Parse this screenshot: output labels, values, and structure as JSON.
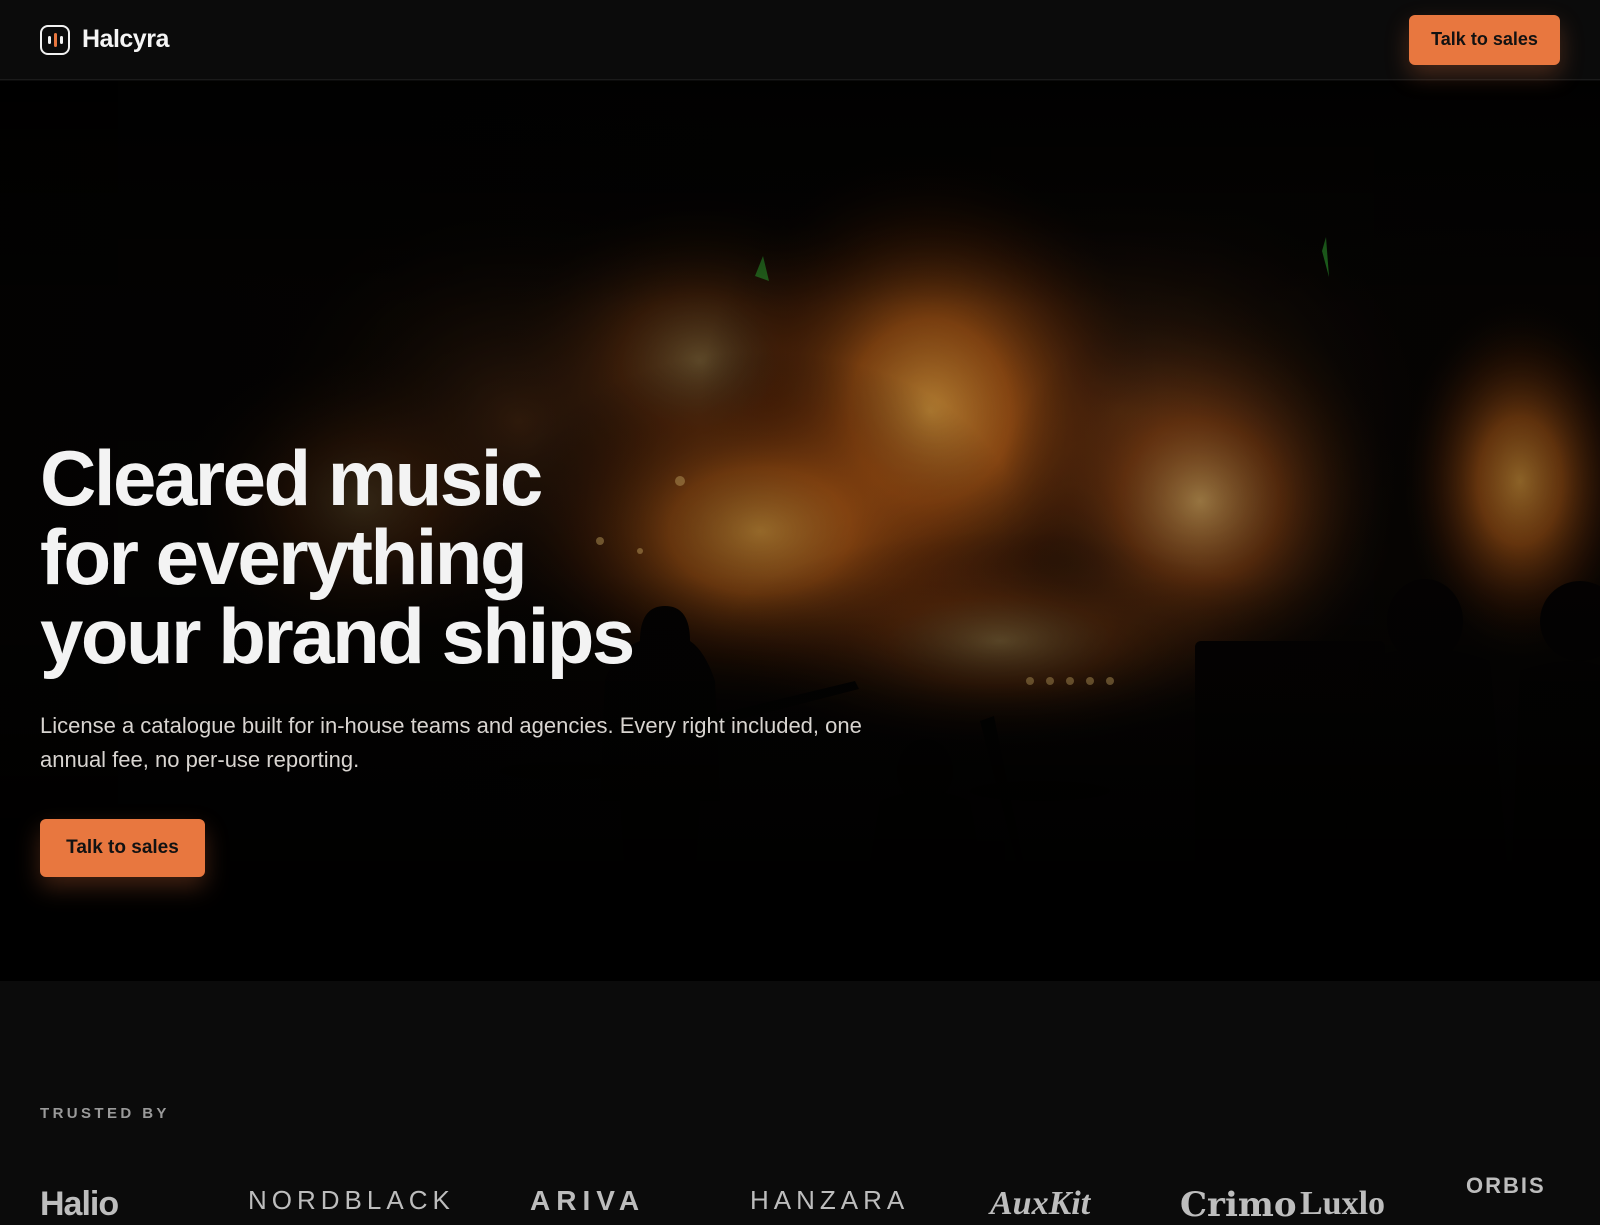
{
  "header": {
    "brand_name": "Halcyra",
    "cta_label": "Talk to sales"
  },
  "hero": {
    "headline_lines": [
      "Cleared music",
      "for everything",
      "your brand ships"
    ],
    "subtext": "License a catalogue built for in-house teams and agencies. Every right included, one annual fee, no per-use reporting.",
    "cta_label": "Talk to sales"
  },
  "trusted": {
    "label": "TRUSTED BY",
    "logos": [
      "Halio",
      "NORDBLACK",
      "ARIVA",
      "HANZARA",
      "AuxKit",
      "Crimo",
      "Luxlo",
      "ORBIS"
    ]
  },
  "colors": {
    "accent": "#e8773f",
    "background": "#0b0b0b",
    "text": "#f2f2f2"
  },
  "icons": {
    "brand_logo": "waveform-badge-icon"
  }
}
